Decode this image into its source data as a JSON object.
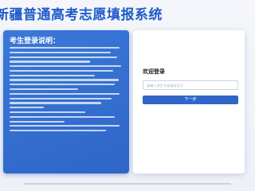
{
  "header": {
    "title": "新疆普通高考志愿填报系统"
  },
  "instructions": {
    "title": "考生登录说明："
  },
  "login": {
    "title": "欢迎登录",
    "exam_id_placeholder": "请输入考生号或身份证号",
    "exam_id_value": "",
    "next_label": "下一步"
  },
  "colors": {
    "primary": "#2f66c8",
    "panel": "#3a78d8",
    "title": "#1f5bc9"
  }
}
